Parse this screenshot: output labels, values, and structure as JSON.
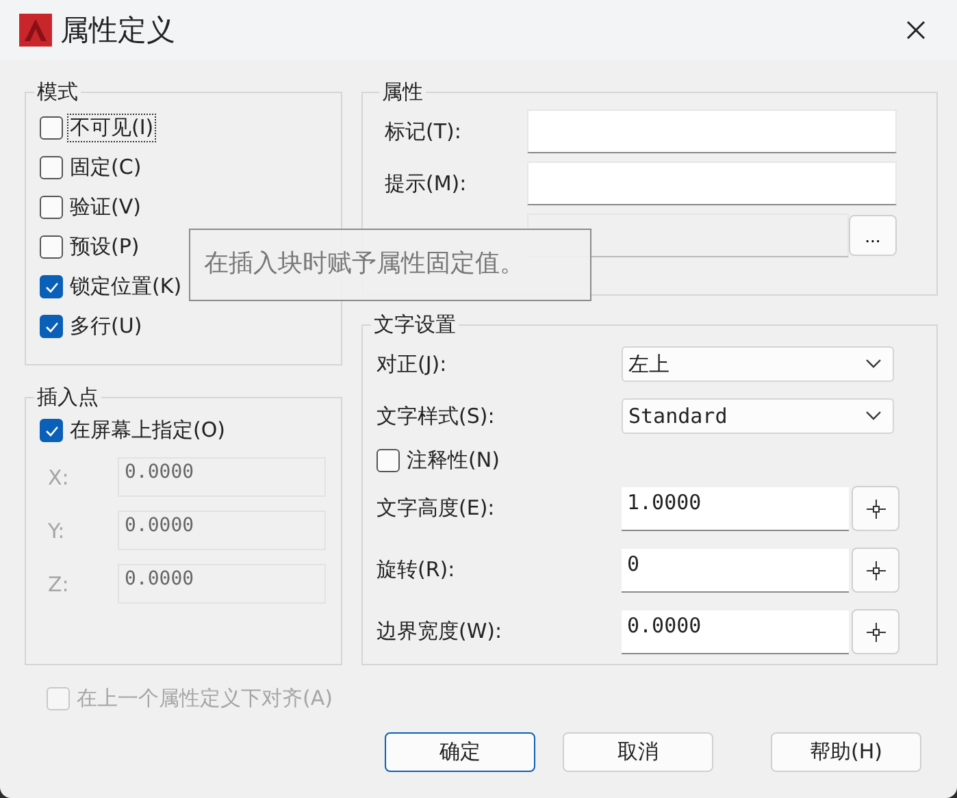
{
  "window": {
    "title": "属性定义"
  },
  "modes": {
    "title": "模式",
    "items": [
      {
        "label": "不可见(I)",
        "checked": false,
        "focused": true
      },
      {
        "label": "固定(C)",
        "checked": false,
        "focused": false
      },
      {
        "label": "验证(V)",
        "checked": false,
        "focused": false
      },
      {
        "label": "预设(P)",
        "checked": false,
        "focused": false
      },
      {
        "label": "锁定位置(K)",
        "checked": true,
        "focused": false
      },
      {
        "label": "多行(U)",
        "checked": true,
        "focused": false
      }
    ]
  },
  "insertion_point": {
    "title": "插入点",
    "on_screen": {
      "label": "在屏幕上指定(O)",
      "checked": true
    },
    "coords": [
      {
        "label": "X:",
        "value": "0.0000",
        "disabled": true
      },
      {
        "label": "Y:",
        "value": "0.0000",
        "disabled": true
      },
      {
        "label": "Z:",
        "value": "0.0000",
        "disabled": true
      }
    ]
  },
  "attribute": {
    "title": "属性",
    "fields": [
      {
        "label": "标记(T):",
        "disabled": false
      },
      {
        "label": "提示(M):",
        "disabled": false
      },
      {
        "disabled": true,
        "button": "..."
      }
    ]
  },
  "tooltip": {
    "text": "在插入块时赋予属性固定值。"
  },
  "text_settings": {
    "title": "文字设置",
    "rows": [
      {
        "kind": "dropdown",
        "label": "对正(J):",
        "value": "左上"
      },
      {
        "kind": "dropdown",
        "label": "文字样式(S):",
        "value": "Standard"
      },
      {
        "kind": "checkbox",
        "label": "注释性(N)",
        "checked": false
      },
      {
        "kind": "pick",
        "label": "文字高度(E):",
        "value": "1.0000"
      },
      {
        "kind": "pick",
        "label": "旋转(R):",
        "value": "0"
      },
      {
        "kind": "pick",
        "label": "边界宽度(W):",
        "value": "0.0000"
      }
    ]
  },
  "align_below": {
    "label": "在上一个属性定义下对齐(A)",
    "checked": false,
    "disabled": true
  },
  "buttons": [
    {
      "label": "确定",
      "default": true
    },
    {
      "label": "取消",
      "default": false
    },
    {
      "label": "帮助(H)",
      "default": false
    }
  ]
}
